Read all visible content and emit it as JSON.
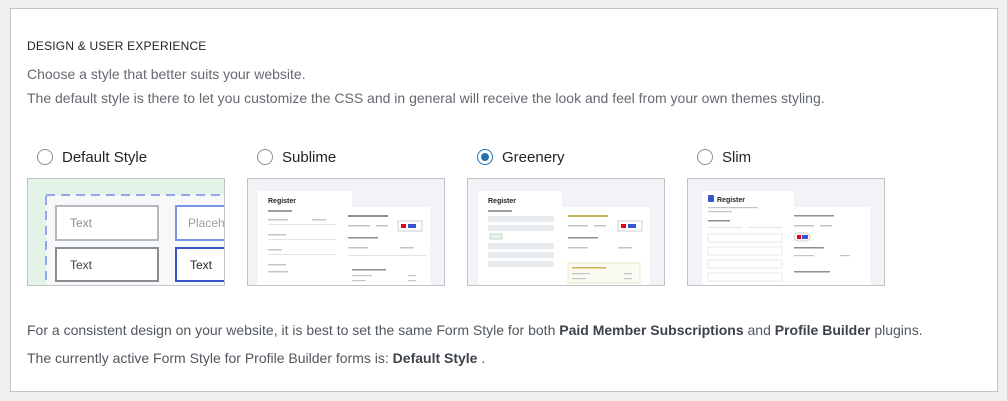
{
  "section": {
    "title": "DESIGN & USER EXPERIENCE",
    "description_line1": "Choose a style that better suits your website.",
    "description_line2": "The default style is there to let you customize the CSS and in general will receive the look and feel from your own themes styling."
  },
  "styles": [
    {
      "label": "Default Style",
      "selected": false
    },
    {
      "label": "Sublime",
      "selected": false
    },
    {
      "label": "Greenery",
      "selected": true
    },
    {
      "label": "Slim",
      "selected": false
    }
  ],
  "previews": {
    "default": {
      "input_text": "Text",
      "placeholder_text": "Placeho"
    },
    "register_title": "Register"
  },
  "footer": {
    "line1_prefix": "For a consistent design on your website, it is best to set the same Form Style for both ",
    "product1": "Paid Member Subscriptions",
    "line1_and": " and ",
    "product2": "Profile Builder",
    "line1_suffix": " plugins.",
    "line2_prefix": "The currently active Form Style for Profile Builder forms is: ",
    "active_style": "Default Style",
    "line2_suffix": " ."
  },
  "colors": {
    "accent": "#2271b1",
    "greenery_bg": "#e6f2ea"
  }
}
